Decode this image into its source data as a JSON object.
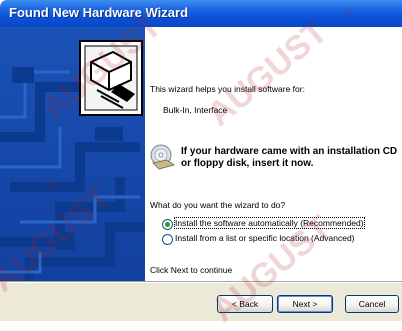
{
  "window": {
    "title": "Found New Hardware Wizard"
  },
  "intro": {
    "text": "This wizard helps you install software for:",
    "device_name": "Bulk-In, Interface"
  },
  "cd_prompt": {
    "icon": "cd-installation-icon",
    "line1": "If your hardware came with an installation CD",
    "line2": "or floppy disk, insert it now."
  },
  "question": "What do you want the wizard to do?",
  "options": [
    {
      "label": "Install the software automatically (Recommended)",
      "selected": true
    },
    {
      "label": "Install from a list or specific location (Advanced)",
      "selected": false
    }
  ],
  "continue_text": "Click Next to continue",
  "buttons": {
    "back": "< Back",
    "next": "Next >",
    "cancel": "Cancel"
  },
  "watermark": {
    "text": "AUGUST",
    "symbol": "®"
  },
  "colors": {
    "title_bar": "#0a4fd6",
    "sidebar": "#1a52b5",
    "footer": "#ece9d8",
    "radio_dot": "#21a121"
  }
}
